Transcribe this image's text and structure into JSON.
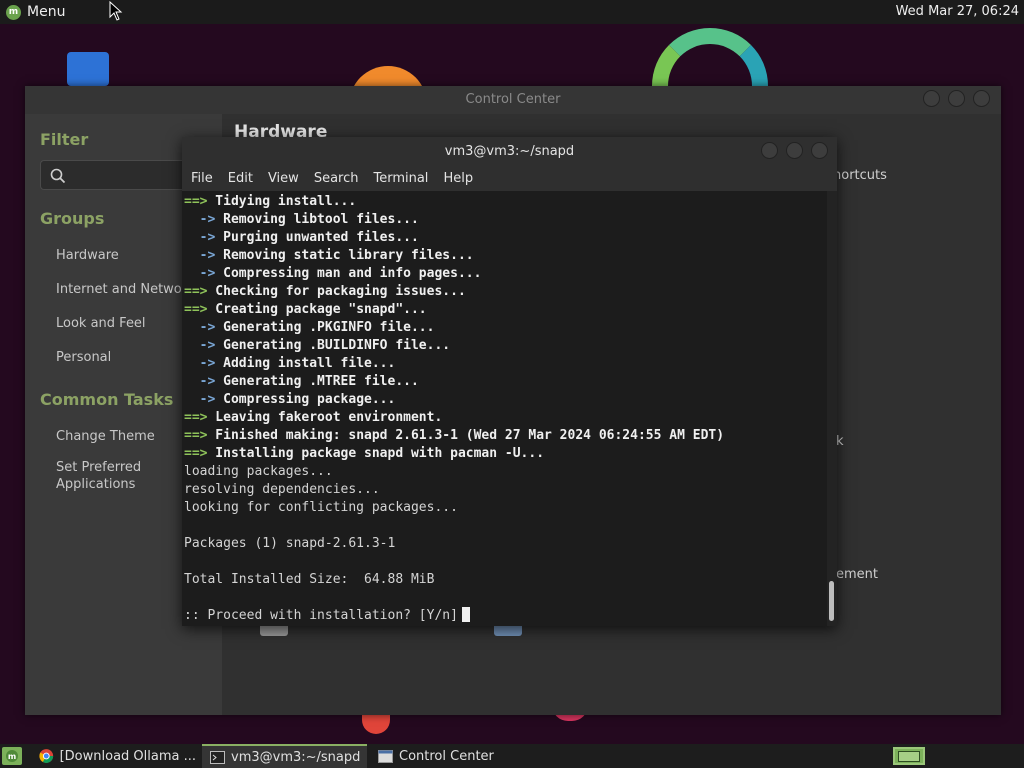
{
  "top_panel": {
    "menu_label": "Menu",
    "clock": "Wed Mar 27, 06:24"
  },
  "control_center": {
    "title": "Control Center",
    "sidebar": {
      "filter_heading": "Filter",
      "groups_heading": "Groups",
      "groups": [
        "Hardware",
        "Internet and Network",
        "Look and Feel",
        "Personal"
      ],
      "tasks_heading": "Common Tasks",
      "tasks": [
        "Change Theme",
        "Set Preferred Applications"
      ]
    },
    "main": {
      "title": "Hardware",
      "partial_labels": [
        "hortcuts",
        "k",
        "ement"
      ]
    }
  },
  "terminal": {
    "title": "vm3@vm3:~/snapd",
    "menu": [
      "File",
      "Edit",
      "View",
      "Search",
      "Terminal",
      "Help"
    ],
    "lines": [
      {
        "kind": "arrow",
        "marker": "==>",
        "text": " Tidying install..."
      },
      {
        "kind": "sub",
        "marker": "  ->",
        "text": " Removing libtool files..."
      },
      {
        "kind": "sub",
        "marker": "  ->",
        "text": " Purging unwanted files..."
      },
      {
        "kind": "sub",
        "marker": "  ->",
        "text": " Removing static library files..."
      },
      {
        "kind": "sub",
        "marker": "  ->",
        "text": " Compressing man and info pages..."
      },
      {
        "kind": "arrow",
        "marker": "==>",
        "text": " Checking for packaging issues..."
      },
      {
        "kind": "arrow",
        "marker": "==>",
        "text": " Creating package \"snapd\"..."
      },
      {
        "kind": "sub",
        "marker": "  ->",
        "text": " Generating .PKGINFO file..."
      },
      {
        "kind": "sub",
        "marker": "  ->",
        "text": " Generating .BUILDINFO file..."
      },
      {
        "kind": "sub",
        "marker": "  ->",
        "text": " Adding install file..."
      },
      {
        "kind": "sub",
        "marker": "  ->",
        "text": " Generating .MTREE file..."
      },
      {
        "kind": "sub",
        "marker": "  ->",
        "text": " Compressing package..."
      },
      {
        "kind": "arrow",
        "marker": "==>",
        "text": " Leaving fakeroot environment."
      },
      {
        "kind": "arrow",
        "marker": "==>",
        "text": " Finished making: snapd 2.61.3-1 (Wed 27 Mar 2024 06:24:55 AM EDT)"
      },
      {
        "kind": "arrow",
        "marker": "==>",
        "text": " Installing package snapd with pacman -U..."
      },
      {
        "kind": "plain",
        "marker": "",
        "text": "loading packages..."
      },
      {
        "kind": "plain",
        "marker": "",
        "text": "resolving dependencies..."
      },
      {
        "kind": "plain",
        "marker": "",
        "text": "looking for conflicting packages..."
      },
      {
        "kind": "plain",
        "marker": "",
        "text": ""
      },
      {
        "kind": "plain",
        "marker": "",
        "text": "Packages (1) snapd-2.61.3-1"
      },
      {
        "kind": "plain",
        "marker": "",
        "text": ""
      },
      {
        "kind": "plain",
        "marker": "",
        "text": "Total Installed Size:  64.88 MiB"
      },
      {
        "kind": "plain",
        "marker": "",
        "text": ""
      },
      {
        "kind": "prompt",
        "marker": "",
        "text": ":: Proceed with installation? [Y/n]"
      }
    ]
  },
  "taskbar": {
    "tasks": [
      {
        "label": "[Download Ollama ...",
        "icon": "chrome-icon"
      },
      {
        "label": "vm3@vm3:~/snapd",
        "icon": "terminal-icon"
      },
      {
        "label": "Control Center",
        "icon": "window-icon"
      }
    ]
  },
  "colors": {
    "accent_green": "#8ca264",
    "arrow_green": "#8fc35a",
    "sub_blue": "#7aa7d6",
    "terminal_bg": "#1c1c1c",
    "wallpaper": "#24091f"
  }
}
